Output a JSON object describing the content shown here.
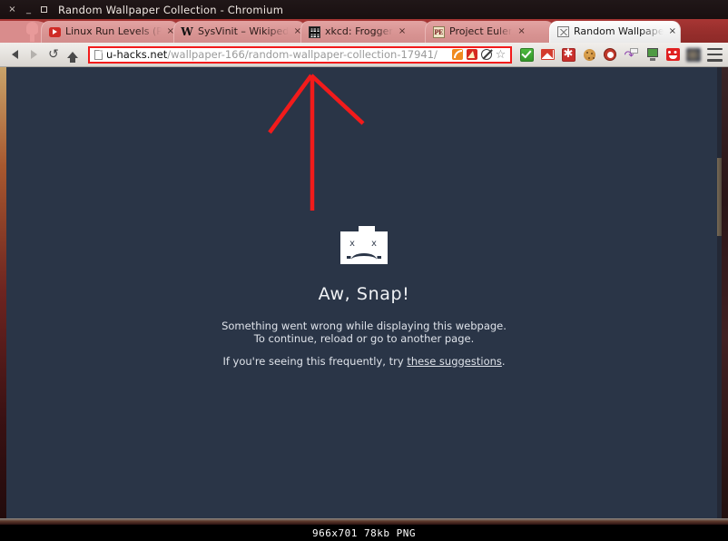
{
  "window": {
    "title": "Random Wallpaper Collection - Chromium",
    "controls": {
      "close": "×",
      "minimize": "_",
      "maximize": "□"
    }
  },
  "tabs": [
    {
      "title": "Linux Run Levels (Pa",
      "favicon": "youtube-icon",
      "close": "×",
      "active": false
    },
    {
      "title": "SysVinit – Wikipedia",
      "favicon": "wikipedia-icon",
      "close": "×",
      "active": false
    },
    {
      "title": "xkcd: Frogger",
      "favicon": "xkcd-icon",
      "close": "×",
      "active": false
    },
    {
      "title": "Project Euler",
      "favicon": "project-euler-icon",
      "close": "×",
      "active": false
    },
    {
      "title": "Random Wallpaper C",
      "favicon": "broken-image-icon",
      "close": "×",
      "active": true
    }
  ],
  "toolbar": {
    "back": "back-arrow-icon",
    "forward": "forward-arrow-icon",
    "reload": "reload-icon",
    "home": "home-icon",
    "omnibox": {
      "page_icon": "page-document-icon",
      "host": "u-hacks.net",
      "path": "/wallpaper-166/random-wallpaper-collection-17941/",
      "full_url": "u-hacks.net/wallpaper-166/random-wallpaper-collection-17941/",
      "inline_icons": [
        {
          "name": "rss-feed-icon"
        },
        {
          "name": "flash-block-icon"
        },
        {
          "name": "noscript-icon"
        },
        {
          "name": "bookmark-star-icon"
        }
      ]
    },
    "extensions": [
      {
        "name": "checkmark-extension-icon"
      },
      {
        "name": "gmail-checker-icon"
      },
      {
        "name": "asterisk-extension-icon"
      },
      {
        "name": "cookie-manager-icon"
      },
      {
        "name": "adblock-icon"
      },
      {
        "name": "sync-page-icon"
      },
      {
        "name": "monitor-extension-icon"
      },
      {
        "name": "smiley-face-extension-icon"
      },
      {
        "name": "blurred-extension-icon"
      }
    ],
    "menu": "hamburger-menu-icon"
  },
  "page": {
    "icon": "sad-folder-icon",
    "eye_glyph": "x",
    "title": "Aw, Snap!",
    "line1": "Something went wrong while displaying this webpage.",
    "line2": "To continue, reload or go to another page.",
    "line3_prefix": "If you're seeing this frequently, try ",
    "link_text": "these suggestions",
    "line3_suffix": "."
  },
  "scrollbar": {
    "name": "page-scrollbar"
  },
  "annotation": {
    "name": "red-arrow-annotation",
    "color": "#f21b1b",
    "points": "tip(343,83) left-wing(297,146) right-wing(400,135) shaft-end(344,232)"
  },
  "footer": {
    "caption": "966x701  78kb  PNG"
  },
  "colors": {
    "page_background": "#2a3547",
    "tabstrip": "#9a2f2d",
    "toolbar": "#e4e1dd",
    "omnibox_highlight": "#f21b1b",
    "annotation_red": "#f21b1b"
  }
}
